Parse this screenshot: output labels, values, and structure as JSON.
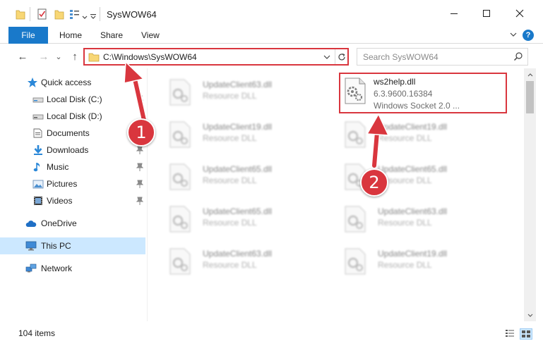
{
  "window": {
    "title": "SysWOW64",
    "minimize_glyph": "—",
    "maximize_glyph": "☐",
    "close_glyph": "✕"
  },
  "ribbon": {
    "tabs": [
      {
        "label": "File"
      },
      {
        "label": "Home"
      },
      {
        "label": "Share"
      },
      {
        "label": "View"
      }
    ],
    "help": "?"
  },
  "nav": {
    "back": "←",
    "forward": "→",
    "recent": "⌄",
    "up": "↑",
    "address": "C:\\Windows\\SysWOW64",
    "search_placeholder": "Search SysWOW64"
  },
  "sidebar": {
    "items": [
      {
        "label": "Quick access",
        "icon": "star-icon"
      },
      {
        "label": "Local Disk (C:)",
        "icon": "drive-icon"
      },
      {
        "label": "Local Disk (D:)",
        "icon": "drive-icon"
      },
      {
        "label": "Documents",
        "icon": "documents-icon"
      },
      {
        "label": "Downloads",
        "icon": "download-icon"
      },
      {
        "label": "Music",
        "icon": "music-icon"
      },
      {
        "label": "Pictures",
        "icon": "pictures-icon"
      },
      {
        "label": "Videos",
        "icon": "videos-icon"
      },
      {
        "label": "OneDrive",
        "icon": "cloud-icon"
      },
      {
        "label": "This PC",
        "icon": "computer-icon"
      },
      {
        "label": "Network",
        "icon": "network-icon"
      }
    ]
  },
  "files": {
    "highlighted": {
      "name": "ws2help.dll",
      "version": "6.3.9600.16384",
      "description": "Windows Socket 2.0 ..."
    },
    "background": [
      {
        "name": "UpdateClient63.dll",
        "type": "Resource DLL"
      },
      {
        "name": "UpdateClient19.dll",
        "type": "Resource DLL"
      },
      {
        "name": "UpdateClient19.dll",
        "type": "Resource DLL"
      },
      {
        "name": "UpdateClient65.dll",
        "type": "Resource DLL"
      },
      {
        "name": "UpdateClient65.dll",
        "type": "Resource DLL"
      },
      {
        "name": "UpdateClient65.dll",
        "type": "Resource DLL"
      },
      {
        "name": "UpdateClient63.dll",
        "type": "Resource DLL"
      },
      {
        "name": "UpdateClient63.dll",
        "type": "Resource DLL"
      },
      {
        "name": "UpdateClient19.dll",
        "type": "Resource DLL"
      }
    ]
  },
  "status": {
    "item_count": "104 items"
  },
  "annotations": {
    "step1": "1",
    "step2": "2",
    "color": "#d9363e"
  },
  "colors": {
    "accent": "#1979ca",
    "selected": "#cce8ff",
    "folder": "#f8d775"
  }
}
